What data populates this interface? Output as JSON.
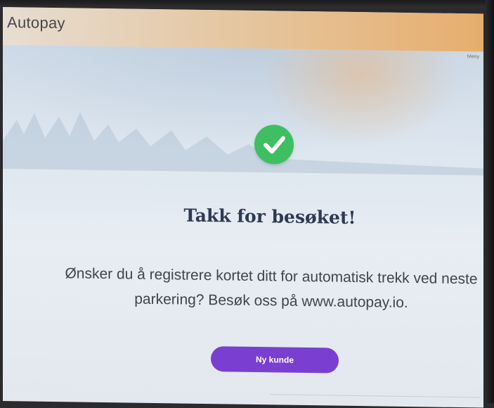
{
  "app": {
    "brand": "Autopay",
    "menu_label": "Meny"
  },
  "main": {
    "title": "Takk for besøket!",
    "message": "Ønsker du å registrere kortet ditt for automatisk trekk ved neste parkering? Besøk oss på www.autopay.io.",
    "button_label": "Ny kunde",
    "status_icon": "check-circle-icon"
  },
  "footer": {
    "version": ""
  },
  "colors": {
    "accent": "#7a3fd0",
    "success": "#3fbf62",
    "title": "#2d3a52",
    "header": "#e6ae6d"
  }
}
